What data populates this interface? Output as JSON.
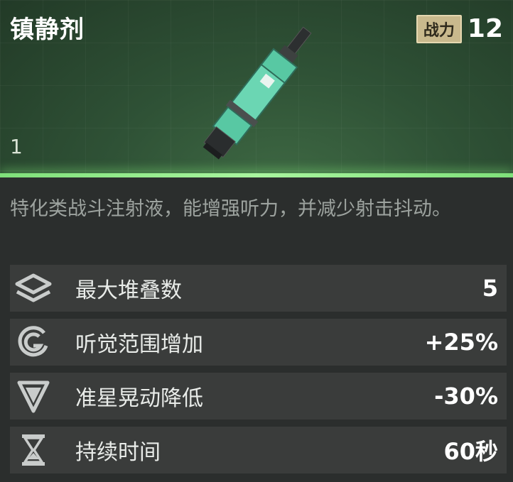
{
  "item": {
    "name": "镇静剂",
    "power_label": "战力",
    "power_value": "12",
    "count": "1",
    "description": "特化类战斗注射液，能增强听力，并减少射击抖动。"
  },
  "stats": [
    {
      "icon": "stack-icon",
      "label": "最大堆叠数",
      "value": "5"
    },
    {
      "icon": "hearing-icon",
      "label": "听觉范围增加",
      "value": "+25%"
    },
    {
      "icon": "crosshair-down-icon",
      "label": "准星晃动降低",
      "value": "-30%"
    },
    {
      "icon": "hourglass-icon",
      "label": "持续时间",
      "value": "60秒"
    }
  ],
  "colors": {
    "accent_green": "#7fe07a",
    "power_badge": "#c9b98d",
    "row_bg": "#3a3c3b"
  }
}
